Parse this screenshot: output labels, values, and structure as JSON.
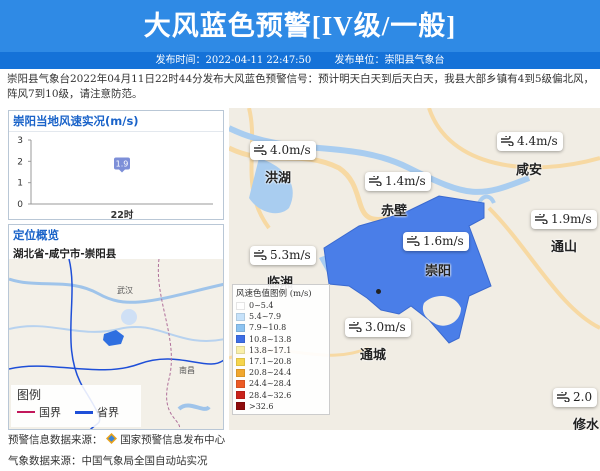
{
  "header": {
    "title": "大风蓝色预警[IV级/一般]",
    "time_label": "发布时间：2022-04-11 22:47:50",
    "unit_label": "发布单位：崇阳县气象台"
  },
  "description": "崇阳县气象台2022年04月11日22时44分发布大风蓝色预警信号：预计明天白天到后天白天，我县大部乡镇有4到5级偏北风，阵风7到10级，请注意防范。",
  "wind_panel": {
    "title": "崇阳当地风速实况(m/s)"
  },
  "chart_data": {
    "type": "scatter",
    "title": "崇阳当地风速实况(m/s)",
    "categories": [
      "22时"
    ],
    "values": [
      1.9
    ],
    "ylim": [
      0,
      3
    ],
    "yticks": [
      0,
      1,
      2,
      3
    ],
    "data_labels": [
      "1.9"
    ]
  },
  "location_panel": {
    "title": "定位概览",
    "region": "湖北省-咸宁市-崇阳县"
  },
  "mini_map": {
    "legend_title": "图例",
    "items": [
      {
        "label": "国界",
        "color": "#c2185b"
      },
      {
        "label": "省界",
        "color": "#1e4fd8"
      }
    ],
    "towns": [
      "武汉",
      "南昌"
    ]
  },
  "map": {
    "wind_labels": [
      {
        "value": "4.0m/s"
      },
      {
        "value": "4.4m/s"
      },
      {
        "value": "1.4m/s"
      },
      {
        "value": "1.9m/s"
      },
      {
        "value": "1.6m/s"
      },
      {
        "value": "5.3m/s"
      },
      {
        "value": "3.0m/s"
      },
      {
        "value": "2.0"
      }
    ],
    "cities": [
      "洪湖",
      "咸安",
      "赤壁",
      "通山",
      "崇阳",
      "临湘",
      "通城",
      "修水"
    ],
    "legend": {
      "title": "风速色值图例 (m/s)",
      "items": [
        {
          "label": "0~5.4",
          "color": "#ffffff"
        },
        {
          "label": "5.4~7.9",
          "color": "#c6e2fa"
        },
        {
          "label": "7.9~10.8",
          "color": "#8cc3f1"
        },
        {
          "label": "10.8~13.8",
          "color": "#3d6ee6"
        },
        {
          "label": "13.8~17.1",
          "color": "#f9efa9"
        },
        {
          "label": "17.1~20.8",
          "color": "#f6d54c"
        },
        {
          "label": "20.8~24.4",
          "color": "#f1a72e"
        },
        {
          "label": "24.4~28.4",
          "color": "#ec5b24"
        },
        {
          "label": "28.4~32.6",
          "color": "#c9221a"
        },
        {
          "label": ">32.6",
          "color": "#8e0c0c"
        }
      ]
    }
  },
  "footer": {
    "warning_source": "预警信息数据来源：",
    "warning_source_name": "国家预警信息发布中心",
    "weather_source": "气象数据来源：中国气象局全国自动站实况"
  },
  "colors": {
    "banner": "#2f8ae5",
    "subbar": "#1572d8",
    "warn_area": "#4a7ee8",
    "accent": "#1a63c9"
  }
}
